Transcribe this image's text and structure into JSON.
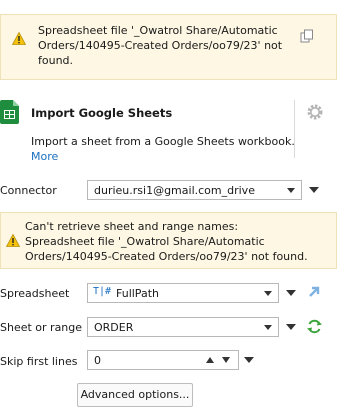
{
  "top_warning": {
    "message": "Spreadsheet file '_Owatrol Share/Automatic\nOrders/140495-Created Orders/oo79/23' not\nfound.",
    "icon": "warning-icon",
    "action_icon": "copy-icon"
  },
  "header": {
    "icon": "google-sheets-icon",
    "title": "Import Google Sheets",
    "description": "Import a sheet from a Google Sheets workbook.",
    "more_link": "More",
    "settings_icon": "gear-icon"
  },
  "connector": {
    "label": "Connector",
    "value": "durieu.rsi1@gmail.com_drive"
  },
  "range_warning": {
    "message": "Can't retrieve sheet and range names:\nSpreadsheet file '_Owatrol Share/Automatic\nOrders/140495-Created Orders/oo79/23' not found.",
    "icon": "warning-icon"
  },
  "spreadsheet": {
    "label": "Spreadsheet",
    "type_icon": "text-field-icon",
    "value": "FullPath",
    "action_icon": "open-link-icon"
  },
  "sheet_or_range": {
    "label": "Sheet or range",
    "value": "ORDER",
    "action_icon": "refresh-icon"
  },
  "skip_first_lines": {
    "label": "Skip first lines",
    "value": "0"
  },
  "advanced_button": "Advanced options...",
  "colors": {
    "warning_bg": "#fdf7e3",
    "link": "#1a6fc0",
    "refresh": "#3aa33a",
    "open_link": "#7fb2e0",
    "sheets_green": "#1e8e3e"
  }
}
